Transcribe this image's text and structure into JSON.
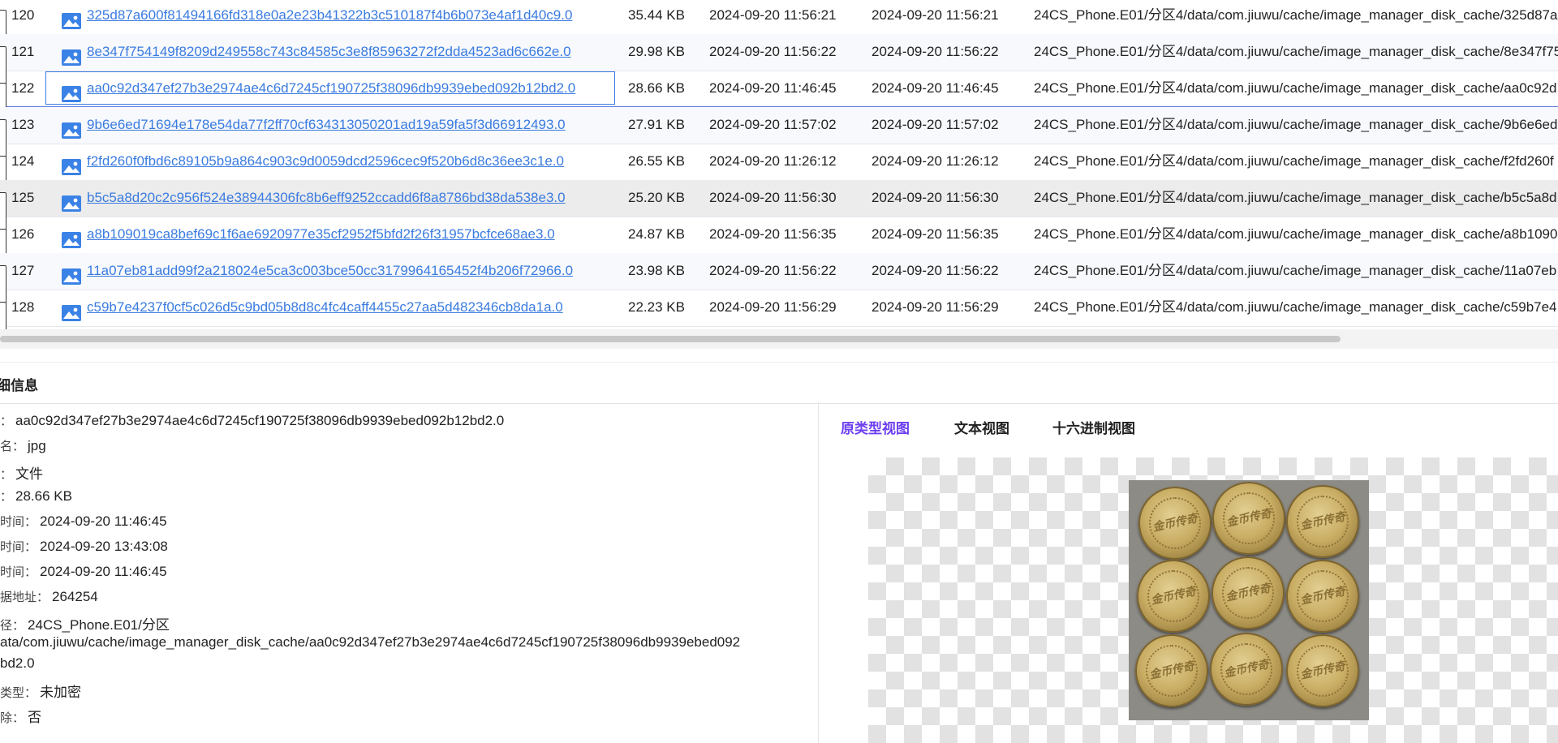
{
  "rows": [
    {
      "idx": "120",
      "name": "325d87a600f81494166fd318e0a2e23b41322b3c510187f4b6b073e4af1d40c9.0",
      "size": "35.44 KB",
      "mtime": "2024-09-20 11:56:21",
      "ctime": "2024-09-20 11:56:21",
      "path": "24CS_Phone.E01/分区4/data/com.jiuwu/cache/image_manager_disk_cache/325d87a"
    },
    {
      "idx": "121",
      "name": "8e347f754149f8209d249558c743c84585c3e8f85963272f2dda4523ad6c662e.0",
      "size": "29.98 KB",
      "mtime": "2024-09-20 11:56:22",
      "ctime": "2024-09-20 11:56:22",
      "path": "24CS_Phone.E01/分区4/data/com.jiuwu/cache/image_manager_disk_cache/8e347f75"
    },
    {
      "idx": "122",
      "name": "aa0c92d347ef27b3e2974ae4c6d7245cf190725f38096db9939ebed092b12bd2.0",
      "size": "28.66 KB",
      "mtime": "2024-09-20 11:46:45",
      "ctime": "2024-09-20 11:46:45",
      "path": "24CS_Phone.E01/分区4/data/com.jiuwu/cache/image_manager_disk_cache/aa0c92d"
    },
    {
      "idx": "123",
      "name": "9b6e6ed71694e178e54da77f2ff70cf634313050201ad19a59fa5f3d66912493.0",
      "size": "27.91 KB",
      "mtime": "2024-09-20 11:57:02",
      "ctime": "2024-09-20 11:57:02",
      "path": "24CS_Phone.E01/分区4/data/com.jiuwu/cache/image_manager_disk_cache/9b6e6ed"
    },
    {
      "idx": "124",
      "name": "f2fd260f0fbd6c89105b9a864c903c9d0059dcd2596cec9f520b6d8c36ee3c1e.0",
      "size": "26.55 KB",
      "mtime": "2024-09-20 11:26:12",
      "ctime": "2024-09-20 11:26:12",
      "path": "24CS_Phone.E01/分区4/data/com.jiuwu/cache/image_manager_disk_cache/f2fd260f"
    },
    {
      "idx": "125",
      "name": "b5c5a8d20c2c956f524e38944306fc8b6eff9252ccadd6f8a8786bd38da538e3.0",
      "size": "25.20 KB",
      "mtime": "2024-09-20 11:56:30",
      "ctime": "2024-09-20 11:56:30",
      "path": "24CS_Phone.E01/分区4/data/com.jiuwu/cache/image_manager_disk_cache/b5c5a8d"
    },
    {
      "idx": "126",
      "name": "a8b109019ca8bef69c1f6ae6920977e35cf2952f5bfd2f26f31957bcfce68ae3.0",
      "size": "24.87 KB",
      "mtime": "2024-09-20 11:56:35",
      "ctime": "2024-09-20 11:56:35",
      "path": "24CS_Phone.E01/分区4/data/com.jiuwu/cache/image_manager_disk_cache/a8b1090"
    },
    {
      "idx": "127",
      "name": "11a07eb81add99f2a218024e5ca3c003bce50cc3179964165452f4b206f72966.0",
      "size": "23.98 KB",
      "mtime": "2024-09-20 11:56:22",
      "ctime": "2024-09-20 11:56:22",
      "path": "24CS_Phone.E01/分区4/data/com.jiuwu/cache/image_manager_disk_cache/11a07eb"
    },
    {
      "idx": "128",
      "name": "c59b7e4237f0cf5c026d5c9bd05b8d8c4fc4caff4455c27aa5d482346cb8da1a.0",
      "size": "22.23 KB",
      "mtime": "2024-09-20 11:56:29",
      "ctime": "2024-09-20 11:56:29",
      "path": "24CS_Phone.E01/分区4/data/com.jiuwu/cache/image_manager_disk_cache/c59b7e4"
    }
  ],
  "selected_index": 2,
  "hover_index": 5,
  "detail": {
    "title": "细信息",
    "props": [
      {
        "key": "：",
        "value": "aa0c92d347ef27b3e2974ae4c6d7245cf190725f38096db9939ebed092b12bd2.0"
      },
      {
        "key": "名：",
        "value": "jpg"
      },
      {
        "key": "：",
        "value": "文件"
      },
      {
        "key": "：",
        "value": "28.66 KB"
      },
      {
        "key": "时间：",
        "value": "2024-09-20 11:46:45"
      },
      {
        "key": "时间：",
        "value": "2024-09-20 13:43:08"
      },
      {
        "key": "时间：",
        "value": "2024-09-20 11:46:45"
      },
      {
        "key": "据地址：",
        "value": "264254"
      },
      {
        "key": "径：",
        "value": "24CS_Phone.E01/分区"
      },
      {
        "key": "",
        "value": "ata/com.jiuwu/cache/image_manager_disk_cache/aa0c92d347ef27b3e2974ae4c6d7245cf190725f38096db9939ebed092"
      },
      {
        "key": "",
        "value": "bd2.0"
      },
      {
        "key": "类型：",
        "value": "未加密"
      },
      {
        "key": "除：",
        "value": "否"
      }
    ]
  },
  "view_tabs": [
    {
      "label": "原类型视图",
      "active": true
    },
    {
      "label": "文本视图",
      "active": false
    },
    {
      "label": "十六进制视图",
      "active": false
    }
  ],
  "preview": {
    "coin_text": "金币传奇"
  },
  "colors": {
    "link": "#3a7be0",
    "active_tab": "#6c3ff0",
    "icon": "#3b82e6"
  }
}
